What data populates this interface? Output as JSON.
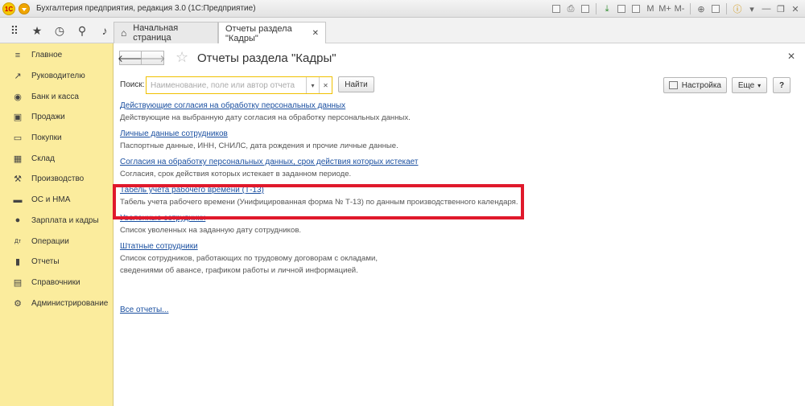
{
  "window": {
    "logo_text": "1С",
    "title": "Бухгалтерия предприятия, редакция 3.0  (1С:Предприятие)"
  },
  "tabs": [
    {
      "label": "Начальная страница"
    },
    {
      "label": "Отчеты раздела \"Кадры\""
    }
  ],
  "sidebar": {
    "items": [
      {
        "label": "Главное",
        "icon": "≡"
      },
      {
        "label": "Руководителю",
        "icon": "↗"
      },
      {
        "label": "Банк и касса",
        "icon": "◉"
      },
      {
        "label": "Продажи",
        "icon": "▣"
      },
      {
        "label": "Покупки",
        "icon": "▭"
      },
      {
        "label": "Склад",
        "icon": "▦"
      },
      {
        "label": "Производство",
        "icon": "⚒"
      },
      {
        "label": "ОС и НМА",
        "icon": "▬"
      },
      {
        "label": "Зарплата и кадры",
        "icon": "●"
      },
      {
        "label": "Операции",
        "icon": "Дт"
      },
      {
        "label": "Отчеты",
        "icon": "▮"
      },
      {
        "label": "Справочники",
        "icon": "▤"
      },
      {
        "label": "Администрирование",
        "icon": "⚙"
      }
    ]
  },
  "main": {
    "title": "Отчеты раздела \"Кадры\"",
    "search": {
      "label": "Поиск:",
      "placeholder": "Наименование, поле или автор отчета"
    },
    "find_label": "Найти",
    "settings_label": "Настройка",
    "more_label": "Еще",
    "help_label": "?",
    "reports": [
      {
        "title": "Действующие согласия на обработку персональных данных",
        "desc": "Действующие на выбранную дату согласия на обработку персональных данных."
      },
      {
        "title": "Личные данные сотрудников",
        "desc": "Паспортные данные, ИНН, СНИЛС, дата рождения и прочие личные данные."
      },
      {
        "title": "Согласия на обработку персональных данных, срок действия которых истекает",
        "desc": "Согласия, срок действия которых истекает в заданном периоде."
      },
      {
        "title": "Табель учета рабочего времени (Т-13)",
        "desc": "Табель учета рабочего времени (Унифицированная форма № Т-13) по данным производственного календаря."
      },
      {
        "title": "Уволенные сотрудники",
        "desc": "Список уволенных на заданную дату сотрудников."
      },
      {
        "title": "Штатные сотрудники",
        "desc": "Список сотрудников, работающих по трудовому договорам с окладами,",
        "desc2": "сведениями об авансе, графиком работы и личной информацией."
      }
    ],
    "all_reports_label": "Все отчеты..."
  },
  "colors": {
    "sidebar_bg": "#fbec9d",
    "link": "#1a4fa0",
    "highlight": "#e0192b"
  }
}
